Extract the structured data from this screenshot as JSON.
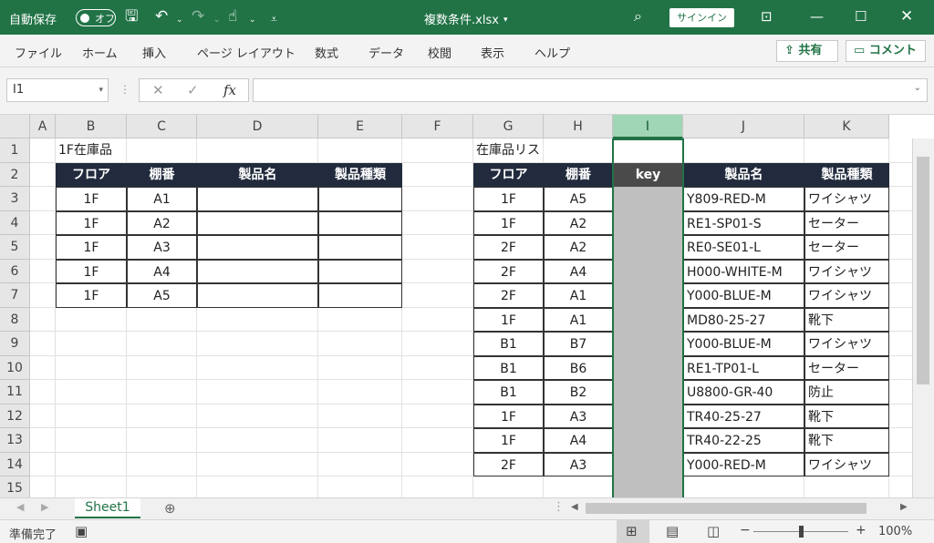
{
  "titlebar": {
    "autosave_label": "自動保存",
    "toggle_label": "オフ",
    "doc_title": "複数条件.xlsx",
    "signin_label": "サインイン"
  },
  "ribbon": {
    "tabs": [
      "ファイル",
      "ホーム",
      "挿入",
      "ページ レイアウト",
      "数式",
      "データ",
      "校閲",
      "表示",
      "ヘルプ"
    ],
    "share_label": "共有",
    "comment_label": "コメント"
  },
  "formula_bar": {
    "name_box": "I1",
    "fx_label": "fx"
  },
  "columns": [
    "A",
    "B",
    "C",
    "D",
    "E",
    "F",
    "G",
    "H",
    "I",
    "J",
    "K"
  ],
  "rows": [
    "1",
    "2",
    "3",
    "4",
    "5",
    "6",
    "7",
    "8",
    "9",
    "10",
    "11",
    "12",
    "13",
    "14",
    "15"
  ],
  "left_table": {
    "title": "1F在庫品",
    "headers": [
      "フロア",
      "棚番",
      "製品名",
      "製品種類"
    ],
    "rows": [
      [
        "1F",
        "A1",
        "",
        ""
      ],
      [
        "1F",
        "A2",
        "",
        ""
      ],
      [
        "1F",
        "A3",
        "",
        ""
      ],
      [
        "1F",
        "A4",
        "",
        ""
      ],
      [
        "1F",
        "A5",
        "",
        ""
      ]
    ]
  },
  "right_table": {
    "title": "在庫品リスト",
    "headers": [
      "フロア",
      "棚番",
      "key",
      "製品名",
      "製品種類"
    ],
    "rows": [
      [
        "1F",
        "A5",
        "",
        "Y809-RED-M",
        "ワイシャツ"
      ],
      [
        "1F",
        "A2",
        "",
        "RE1-SP01-S",
        "セーター"
      ],
      [
        "2F",
        "A2",
        "",
        "RE0-SE01-L",
        "セーター"
      ],
      [
        "2F",
        "A4",
        "",
        "H000-WHITE-M",
        "ワイシャツ"
      ],
      [
        "2F",
        "A1",
        "",
        "Y000-BLUE-M",
        "ワイシャツ"
      ],
      [
        "1F",
        "A1",
        "",
        "MD80-25-27",
        "靴下"
      ],
      [
        "B1",
        "B7",
        "",
        "Y000-BLUE-M",
        "ワイシャツ"
      ],
      [
        "B1",
        "B6",
        "",
        "RE1-TP01-L",
        "セーター"
      ],
      [
        "B1",
        "B2",
        "",
        "U8800-GR-40",
        "防止"
      ],
      [
        "1F",
        "A3",
        "",
        "TR40-25-27",
        "靴下"
      ],
      [
        "1F",
        "A4",
        "",
        "TR40-22-25",
        "靴下"
      ],
      [
        "2F",
        "A3",
        "",
        "Y000-RED-M",
        "ワイシャツ"
      ]
    ]
  },
  "sheets": [
    "Sheet1"
  ],
  "status": {
    "ready": "準備完了",
    "zoom": "100%"
  },
  "colors": {
    "accent": "#217346",
    "header_fill": "#222b3d",
    "key_fill": "#bfbfbf"
  }
}
